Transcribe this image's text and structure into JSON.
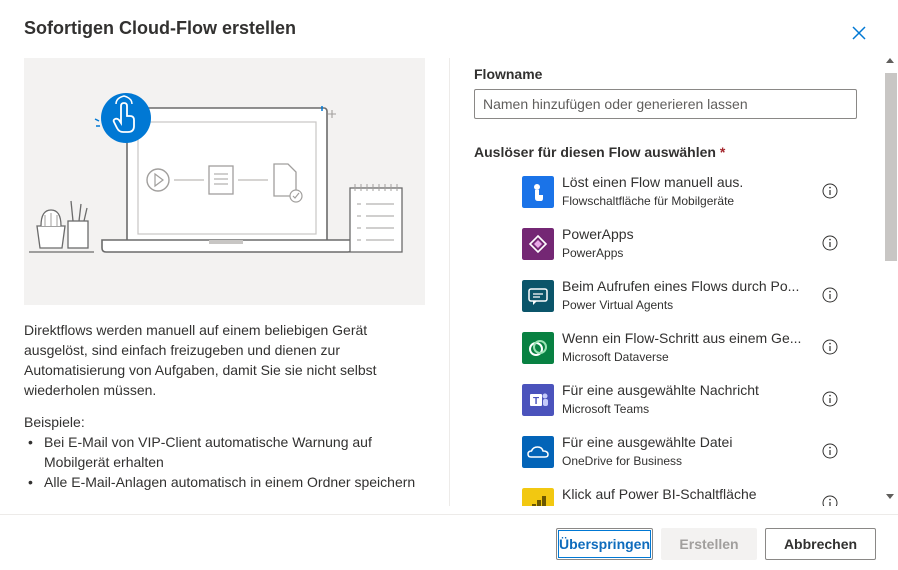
{
  "dialog": {
    "title": "Sofortigen Cloud-Flow erstellen",
    "close_icon": "close-icon"
  },
  "left": {
    "description": "Direktflows werden manuell auf einem beliebigen Gerät ausgelöst, sind einfach freizugeben und dienen zur Automatisierung von Aufgaben, damit Sie sie nicht selbst wiederholen müssen.",
    "examples_title": "Beispiele:",
    "examples": [
      "Bei E-Mail von VIP-Client automatische Warnung auf Mobilgerät erhalten",
      "Alle E-Mail-Anlagen automatisch in einem Ordner speichern"
    ]
  },
  "right": {
    "flowname_label": "Flowname",
    "flowname_placeholder": "Namen hinzufügen oder generieren lassen",
    "flowname_value": "",
    "trigger_label": "Auslöser für diesen Flow auswählen",
    "trigger_required_mark": "*",
    "triggers": [
      {
        "title": "Löst einen Flow manuell aus.",
        "subtitle": "Flowschaltfläche für Mobilgeräte",
        "icon": "touch-icon",
        "color": "#1a73e8"
      },
      {
        "title": "PowerApps",
        "subtitle": "PowerApps",
        "icon": "powerapps-icon",
        "color": "#742774"
      },
      {
        "title": "Beim Aufrufen eines Flows durch Po...",
        "subtitle": "Power Virtual Agents",
        "icon": "chat-bot-icon",
        "color": "#0b556a"
      },
      {
        "title": "Wenn ein Flow-Schritt aus einem Ge...",
        "subtitle": "Microsoft Dataverse",
        "icon": "dataverse-icon",
        "color": "#088142"
      },
      {
        "title": "Für eine ausgewählte Nachricht",
        "subtitle": "Microsoft Teams",
        "icon": "teams-icon",
        "color": "#4b53bc"
      },
      {
        "title": "Für eine ausgewählte Datei",
        "subtitle": "OneDrive for Business",
        "icon": "onedrive-icon",
        "color": "#0364b8"
      },
      {
        "title": "Klick auf Power BI-Schaltfläche",
        "subtitle": "",
        "icon": "powerbi-icon",
        "color": "#f2c811"
      }
    ],
    "info_icon": "info-icon"
  },
  "footer": {
    "skip_label": "Überspringen",
    "create_label": "Erstellen",
    "cancel_label": "Abbrechen"
  },
  "colors": {
    "accent": "#0078d4",
    "illustration_bg": "#f3f2f1",
    "required": "#a4262c"
  }
}
